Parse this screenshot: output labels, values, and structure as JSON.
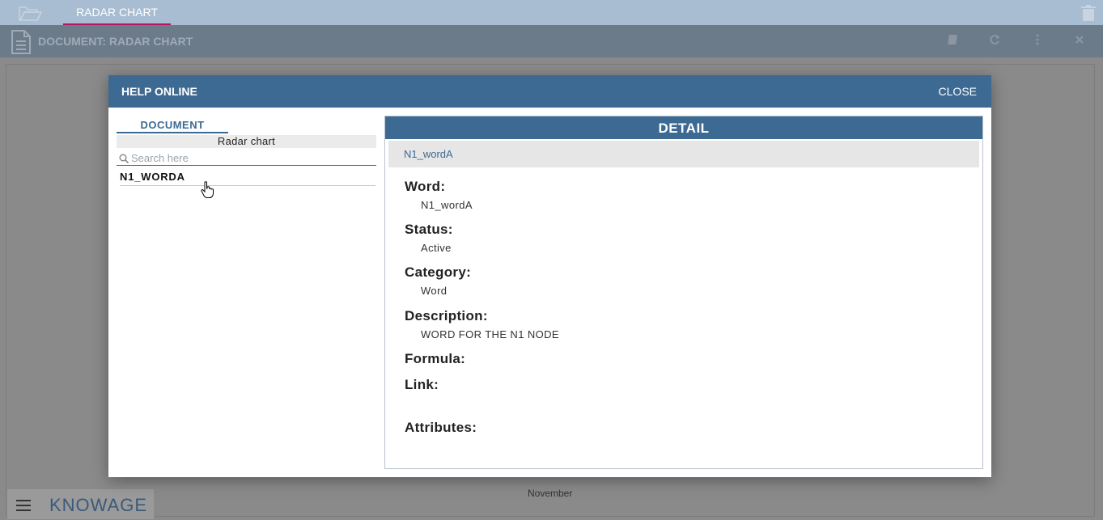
{
  "topbar": {
    "tab_label": "RADAR CHART"
  },
  "document_header": {
    "title": "DOCUMENT: RADAR CHART"
  },
  "background": {
    "month_label": "November"
  },
  "branding": {
    "logo_text": "KNOWAGE"
  },
  "dialog": {
    "title": "HELP ONLINE",
    "close_label": "CLOSE",
    "left": {
      "tab_label": "DOCUMENT",
      "document_name": "Radar chart",
      "search_placeholder": "Search here",
      "items": [
        "N1_WORDA"
      ]
    },
    "detail": {
      "header": "DETAIL",
      "selected_word": "N1_wordA",
      "fields": {
        "word_label": "Word:",
        "word_value": "N1_wordA",
        "status_label": "Status:",
        "status_value": "Active",
        "category_label": "Category:",
        "category_value": "Word",
        "description_label": "Description:",
        "description_value": "WORD FOR THE N1 NODE",
        "formula_label": "Formula:",
        "link_label": "Link:",
        "attributes_label": "Attributes:"
      }
    }
  },
  "colors": {
    "primary": "#3d6a92",
    "tab_accent": "#b3155e",
    "topbar": "#a9bdd2"
  }
}
